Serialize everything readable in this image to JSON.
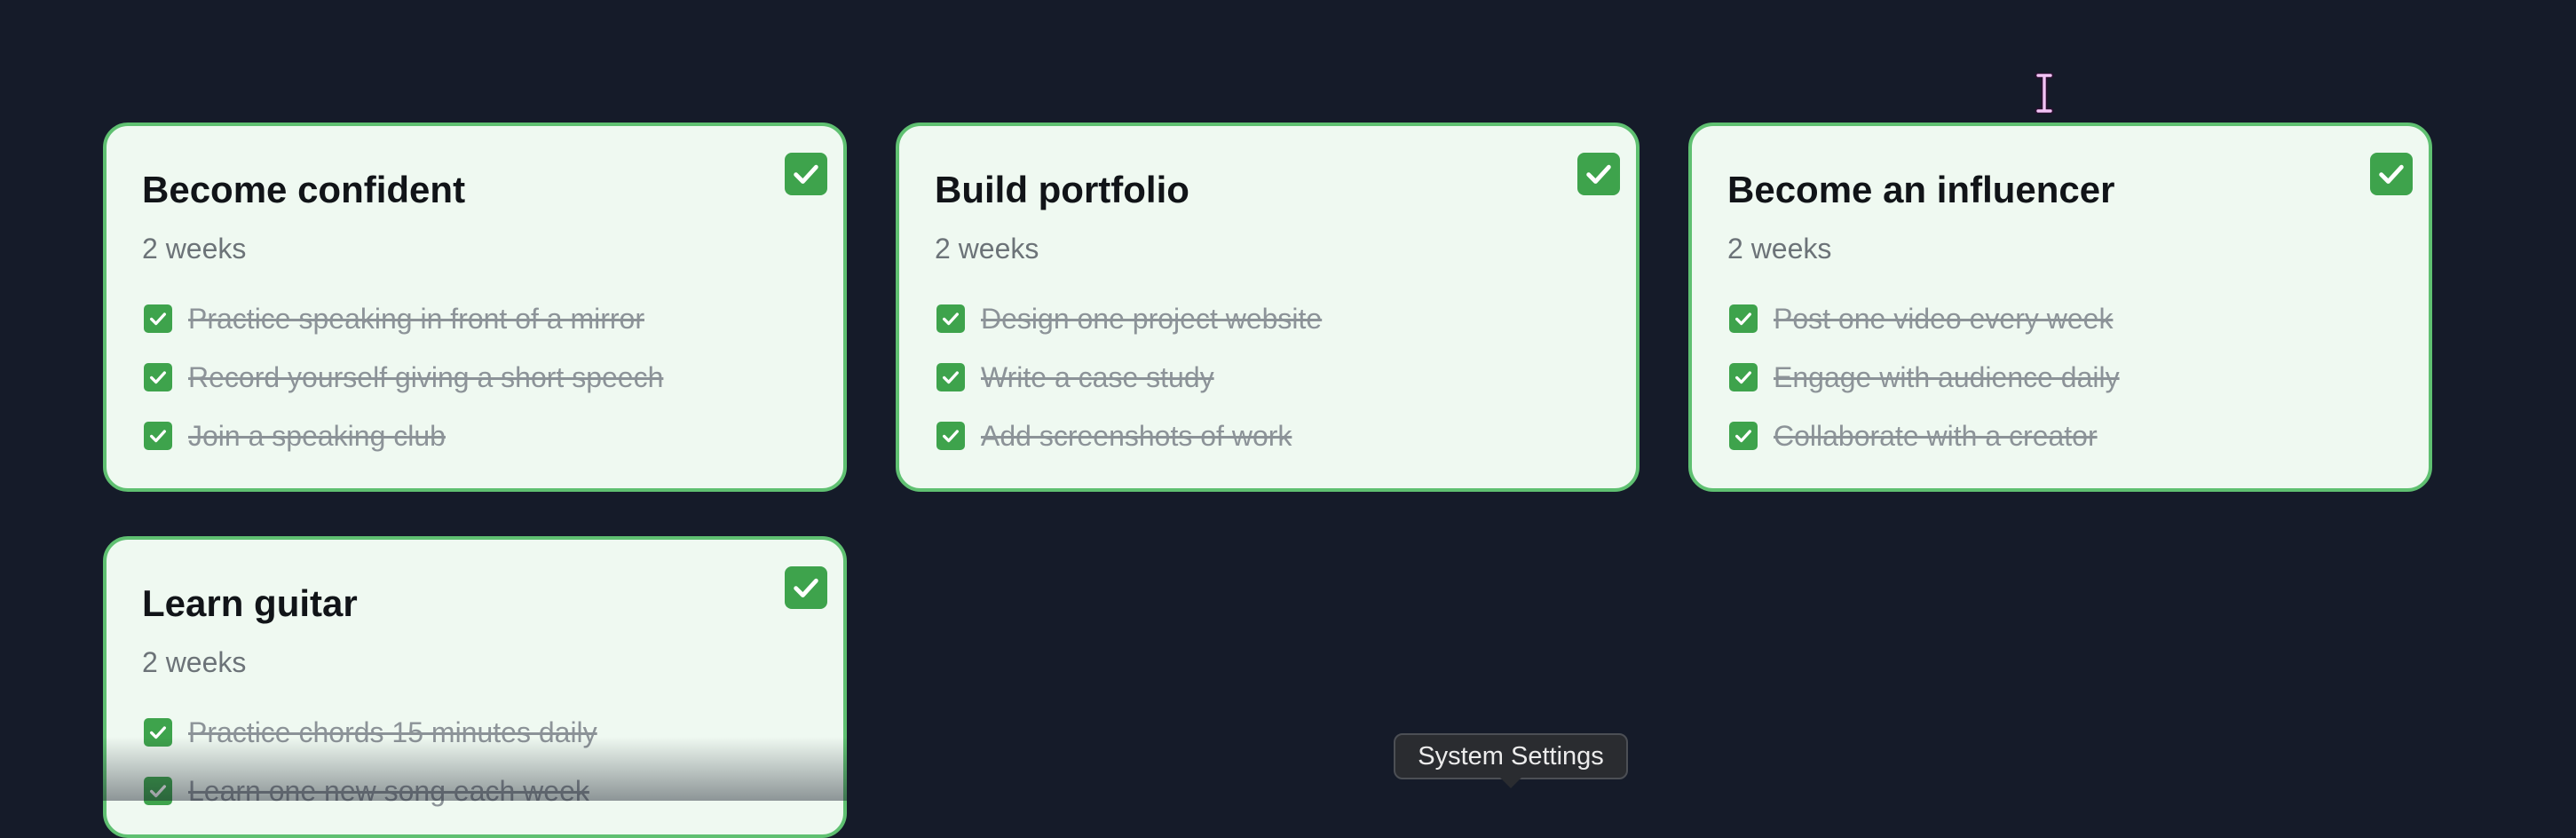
{
  "goals": [
    {
      "title": "Become confident",
      "duration": "2 weeks",
      "done": true,
      "tasks": [
        {
          "label": "Practice speaking in front of a mirror",
          "done": true
        },
        {
          "label": "Record yourself giving a short speech",
          "done": true
        },
        {
          "label": "Join a speaking club",
          "done": true
        }
      ]
    },
    {
      "title": "Build portfolio",
      "duration": "2 weeks",
      "done": true,
      "tasks": [
        {
          "label": "Design one project website",
          "done": true
        },
        {
          "label": "Write a case study",
          "done": true
        },
        {
          "label": "Add screenshots of work",
          "done": true
        }
      ]
    },
    {
      "title": "Become an influencer",
      "duration": "2 weeks",
      "done": true,
      "tasks": [
        {
          "label": "Post one video every week",
          "done": true
        },
        {
          "label": "Engage with audience daily",
          "done": true
        },
        {
          "label": "Collaborate with a creator",
          "done": true
        }
      ]
    },
    {
      "title": "Learn guitar",
      "duration": "2 weeks",
      "done": true,
      "tasks": [
        {
          "label": "Practice chords 15 minutes daily",
          "done": true
        },
        {
          "label": "Learn one new song each week",
          "done": true
        }
      ]
    }
  ],
  "tooltip": {
    "text": "System Settings"
  },
  "icons": {
    "card_done": "check-box-icon",
    "task_done": "checkbox-checked-icon",
    "cursor": "text-cursor-icon"
  },
  "colors": {
    "background": "#151b29",
    "card_background": "#eff9f1",
    "card_border": "#5fc071",
    "accent_green": "#3ea34c"
  }
}
